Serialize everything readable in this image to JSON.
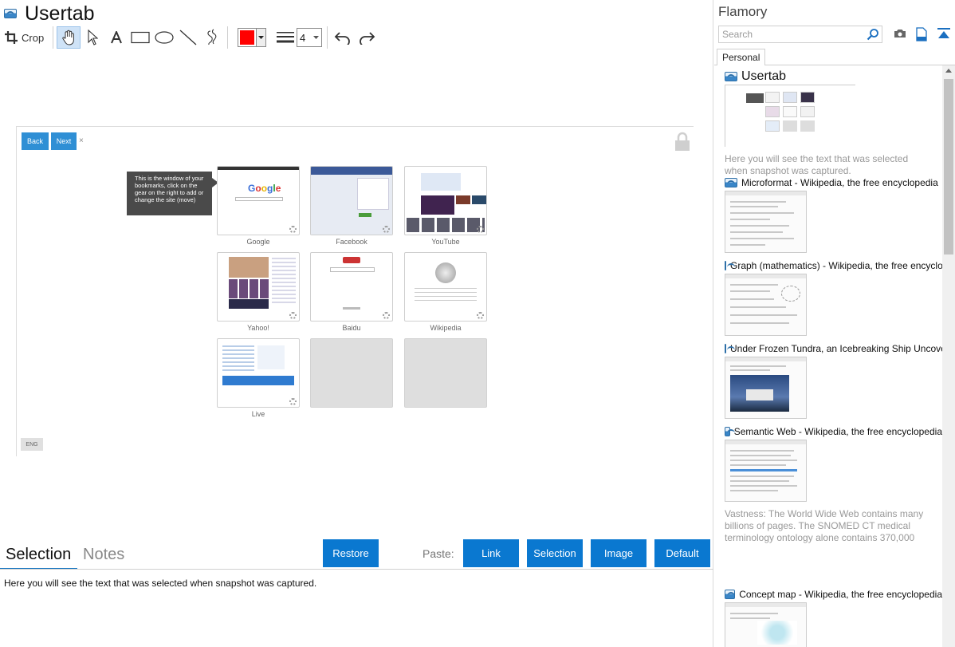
{
  "app": {
    "window_title": "Usertab"
  },
  "toolbar": {
    "crop_label": "Crop",
    "line_width": "4",
    "stroke_color": "#ff0000",
    "tools": [
      "hand-icon",
      "pointer-icon",
      "text-icon",
      "rectangle-icon",
      "ellipse-icon",
      "line-icon",
      "freehand-icon",
      "undo-icon",
      "redo-icon"
    ]
  },
  "preview": {
    "back_label": "Back",
    "next_label": "Next",
    "close_glyph": "×",
    "tooltip": "This is the window of your bookmarks, click on the gear on the right to add or change the site (move)",
    "lang_label": "ENG",
    "tiles": [
      "Google",
      "Facebook",
      "YouTube",
      "Yahoo!",
      "Baidu",
      "Wikipedia",
      "Live",
      "",
      ""
    ]
  },
  "bottom": {
    "tab_selection": "Selection",
    "tab_notes": "Notes",
    "restore_label": "Restore",
    "paste_label": "Paste:",
    "paste_buttons": {
      "link": "Link",
      "selection": "Selection",
      "image": "Image",
      "default": "Default"
    },
    "selected_text": "Here you will see the text that was selected when snapshot was captured.",
    "accent_color": "#0a78d0"
  },
  "sidebar": {
    "title": "Flamory",
    "search_placeholder": "Search",
    "tab_personal": "Personal",
    "items": [
      {
        "title": "Usertab",
        "description": "Here you will see the text that was selected when snapshot was captured."
      },
      {
        "title": "Microformat - Wikipedia, the free encyclopedia",
        "description": ""
      },
      {
        "title": "Graph (mathematics) - Wikipedia, the free encyclopedia",
        "description": ""
      },
      {
        "title": "Under Frozen Tundra, an Icebreaking Ship Uncovers",
        "description": ""
      },
      {
        "title": "Semantic Web - Wikipedia, the free encyclopedia",
        "description": "Vastness: The World Wide Web contains many billions of pages. The SNOMED CT medical terminology ontology alone contains 370,000 class names, and existing technology has not yet been able to eliminate all semantically duplicated terms. Any automated reasoning system will have to deal with truly huge inputs."
      },
      {
        "title": "Concept map - Wikipedia, the free encyclopedia",
        "description": ""
      }
    ]
  }
}
